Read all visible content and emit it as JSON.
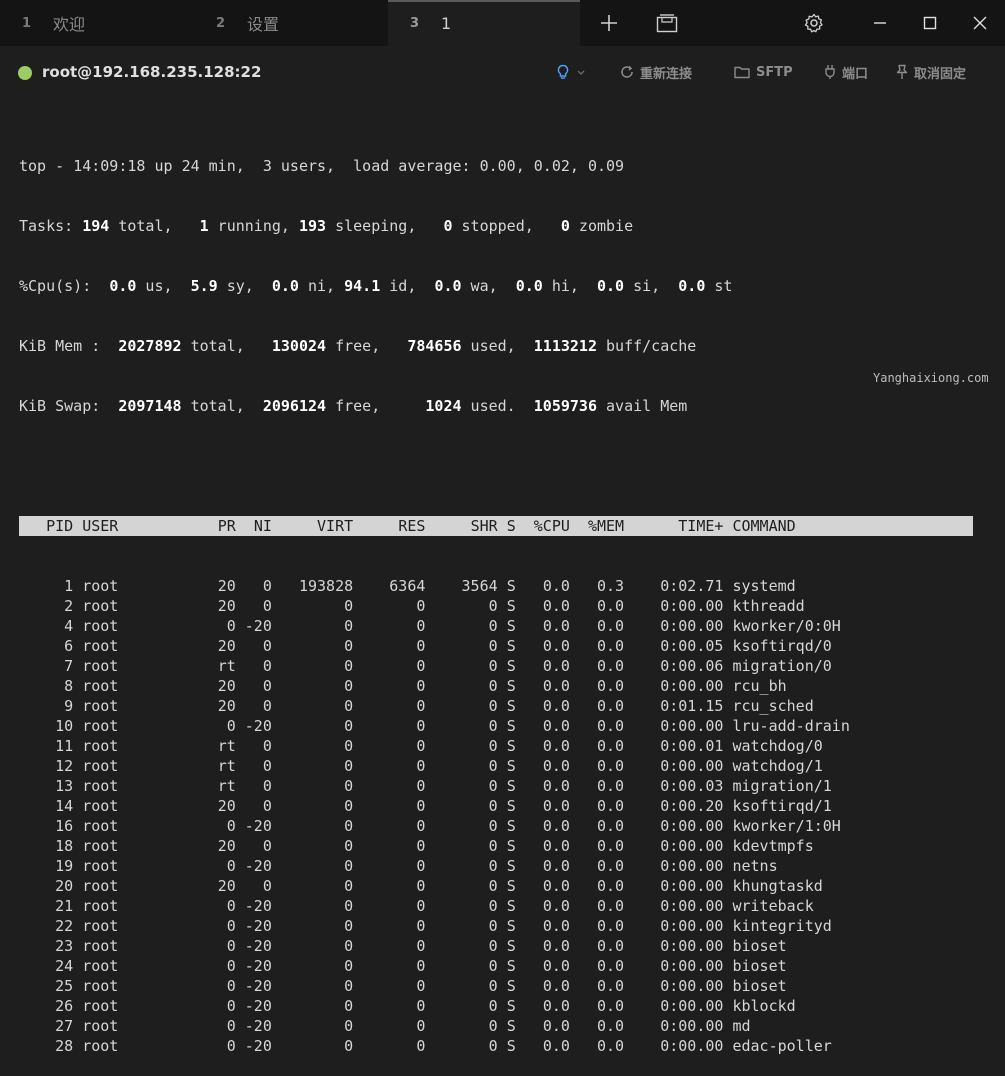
{
  "tabs": [
    {
      "num": "1",
      "label": "欢迎"
    },
    {
      "num": "2",
      "label": "设置"
    },
    {
      "num": "3",
      "label": "1"
    }
  ],
  "connection": {
    "host": "root@192.168.235.128:22",
    "status_color": "#9ccc65"
  },
  "toolbar": {
    "reconnect": "重新连接",
    "sftp": "SFTP",
    "port": "端口",
    "unpin": "取消固定"
  },
  "summary": {
    "l1": {
      "time": "14:09:18",
      "up": "24 min",
      "users": "3",
      "load": "0.00, 0.02, 0.09"
    },
    "l2": {
      "total": "194",
      "running": "1",
      "sleeping": "193",
      "stopped": "0",
      "zombie": "0"
    },
    "l3": {
      "us": "0.0",
      "sy": "5.9",
      "ni": "0.0",
      "id": "94.1",
      "wa": "0.0",
      "hi": "0.0",
      "si": "0.0",
      "st": "0.0"
    },
    "l4": {
      "total": "2027892",
      "free": "130024",
      "used": "784656",
      "buff": "1113212"
    },
    "l5": {
      "total": "2097148",
      "free": "2096124",
      "used": "1024",
      "avail": "1059736"
    }
  },
  "table": {
    "columns": [
      "PID",
      "USER",
      "PR",
      "NI",
      "VIRT",
      "RES",
      "SHR",
      "S",
      "%CPU",
      "%MEM",
      "TIME+",
      "COMMAND"
    ],
    "rows": [
      [
        "1",
        "root",
        "20",
        "0",
        "193828",
        "6364",
        "3564",
        "S",
        "0.0",
        "0.3",
        "0:02.71",
        "systemd"
      ],
      [
        "2",
        "root",
        "20",
        "0",
        "0",
        "0",
        "0",
        "S",
        "0.0",
        "0.0",
        "0:00.00",
        "kthreadd"
      ],
      [
        "4",
        "root",
        "0",
        "-20",
        "0",
        "0",
        "0",
        "S",
        "0.0",
        "0.0",
        "0:00.00",
        "kworker/0:0H"
      ],
      [
        "6",
        "root",
        "20",
        "0",
        "0",
        "0",
        "0",
        "S",
        "0.0",
        "0.0",
        "0:00.05",
        "ksoftirqd/0"
      ],
      [
        "7",
        "root",
        "rt",
        "0",
        "0",
        "0",
        "0",
        "S",
        "0.0",
        "0.0",
        "0:00.06",
        "migration/0"
      ],
      [
        "8",
        "root",
        "20",
        "0",
        "0",
        "0",
        "0",
        "S",
        "0.0",
        "0.0",
        "0:00.00",
        "rcu_bh"
      ],
      [
        "9",
        "root",
        "20",
        "0",
        "0",
        "0",
        "0",
        "S",
        "0.0",
        "0.0",
        "0:01.15",
        "rcu_sched"
      ],
      [
        "10",
        "root",
        "0",
        "-20",
        "0",
        "0",
        "0",
        "S",
        "0.0",
        "0.0",
        "0:00.00",
        "lru-add-drain"
      ],
      [
        "11",
        "root",
        "rt",
        "0",
        "0",
        "0",
        "0",
        "S",
        "0.0",
        "0.0",
        "0:00.01",
        "watchdog/0"
      ],
      [
        "12",
        "root",
        "rt",
        "0",
        "0",
        "0",
        "0",
        "S",
        "0.0",
        "0.0",
        "0:00.00",
        "watchdog/1"
      ],
      [
        "13",
        "root",
        "rt",
        "0",
        "0",
        "0",
        "0",
        "S",
        "0.0",
        "0.0",
        "0:00.03",
        "migration/1"
      ],
      [
        "14",
        "root",
        "20",
        "0",
        "0",
        "0",
        "0",
        "S",
        "0.0",
        "0.0",
        "0:00.20",
        "ksoftirqd/1"
      ],
      [
        "16",
        "root",
        "0",
        "-20",
        "0",
        "0",
        "0",
        "S",
        "0.0",
        "0.0",
        "0:00.00",
        "kworker/1:0H"
      ],
      [
        "18",
        "root",
        "20",
        "0",
        "0",
        "0",
        "0",
        "S",
        "0.0",
        "0.0",
        "0:00.00",
        "kdevtmpfs"
      ],
      [
        "19",
        "root",
        "0",
        "-20",
        "0",
        "0",
        "0",
        "S",
        "0.0",
        "0.0",
        "0:00.00",
        "netns"
      ],
      [
        "20",
        "root",
        "20",
        "0",
        "0",
        "0",
        "0",
        "S",
        "0.0",
        "0.0",
        "0:00.00",
        "khungtaskd"
      ],
      [
        "21",
        "root",
        "0",
        "-20",
        "0",
        "0",
        "0",
        "S",
        "0.0",
        "0.0",
        "0:00.00",
        "writeback"
      ],
      [
        "22",
        "root",
        "0",
        "-20",
        "0",
        "0",
        "0",
        "S",
        "0.0",
        "0.0",
        "0:00.00",
        "kintegrityd"
      ],
      [
        "23",
        "root",
        "0",
        "-20",
        "0",
        "0",
        "0",
        "S",
        "0.0",
        "0.0",
        "0:00.00",
        "bioset"
      ],
      [
        "24",
        "root",
        "0",
        "-20",
        "0",
        "0",
        "0",
        "S",
        "0.0",
        "0.0",
        "0:00.00",
        "bioset"
      ],
      [
        "25",
        "root",
        "0",
        "-20",
        "0",
        "0",
        "0",
        "S",
        "0.0",
        "0.0",
        "0:00.00",
        "bioset"
      ],
      [
        "26",
        "root",
        "0",
        "-20",
        "0",
        "0",
        "0",
        "S",
        "0.0",
        "0.0",
        "0:00.00",
        "kblockd"
      ],
      [
        "27",
        "root",
        "0",
        "-20",
        "0",
        "0",
        "0",
        "S",
        "0.0",
        "0.0",
        "0:00.00",
        "md"
      ],
      [
        "28",
        "root",
        "0",
        "-20",
        "0",
        "0",
        "0",
        "S",
        "0.0",
        "0.0",
        "0:00.00",
        "edac-poller"
      ]
    ]
  },
  "watermark": "Yanghaixiong.com"
}
